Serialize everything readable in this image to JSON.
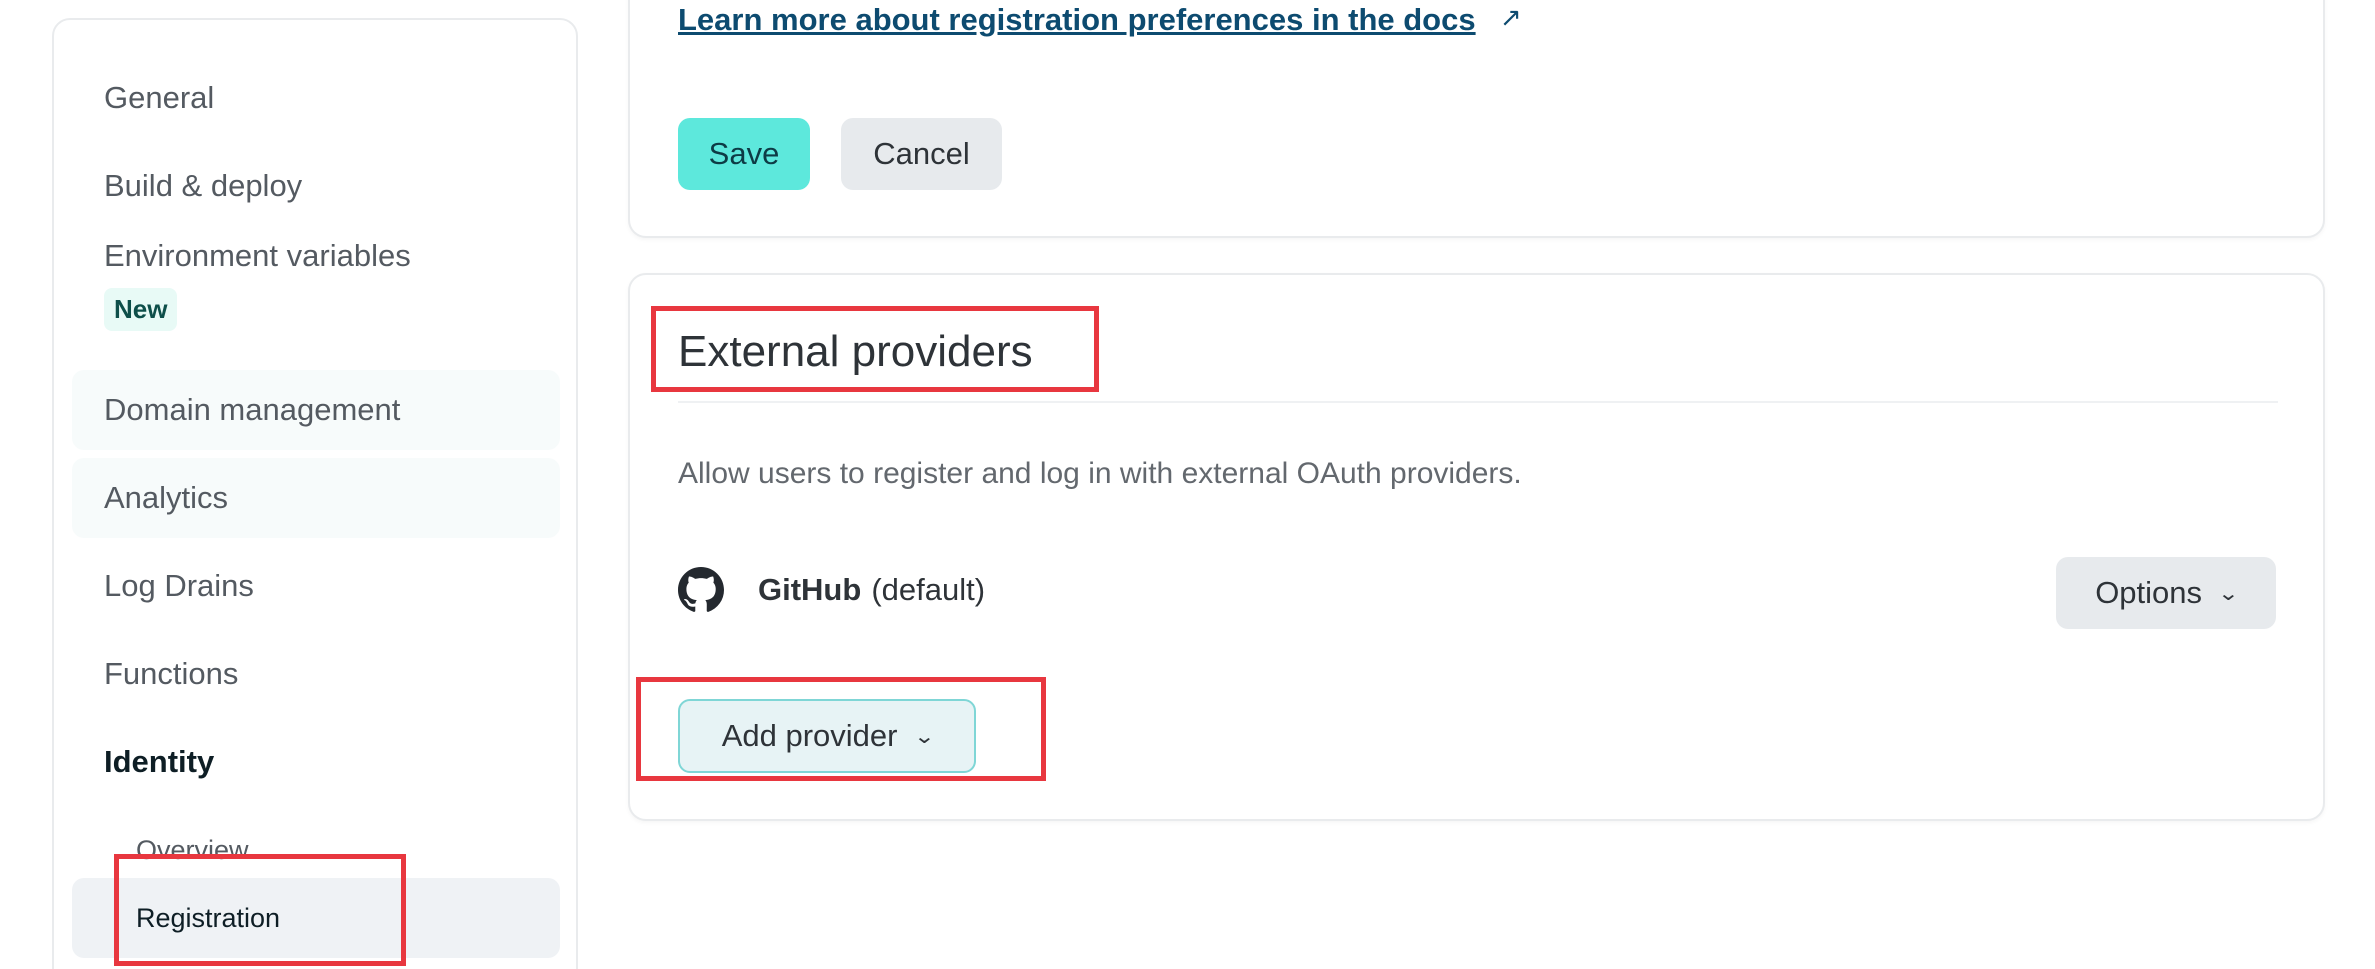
{
  "sidebar": {
    "items": [
      {
        "label": "General"
      },
      {
        "label": "Build & deploy"
      },
      {
        "label": "Environment variables",
        "badge": "New"
      },
      {
        "label": "Domain management"
      },
      {
        "label": "Analytics"
      },
      {
        "label": "Log Drains"
      },
      {
        "label": "Functions"
      },
      {
        "label": "Identity"
      },
      {
        "label": "Overview"
      },
      {
        "label": "Registration"
      }
    ]
  },
  "registration": {
    "docs_link": "Learn more about registration preferences in the docs",
    "save_label": "Save",
    "cancel_label": "Cancel"
  },
  "external_providers": {
    "title": "External providers",
    "description": "Allow users to register and log in with external OAuth providers.",
    "provider": {
      "name": "GitHub",
      "suffix": "(default)",
      "icon": "github-icon"
    },
    "options_label": "Options",
    "add_label": "Add provider"
  },
  "colors": {
    "accent": "#5de8dc",
    "highlight": "#e8373f",
    "link": "#0d4b70"
  }
}
